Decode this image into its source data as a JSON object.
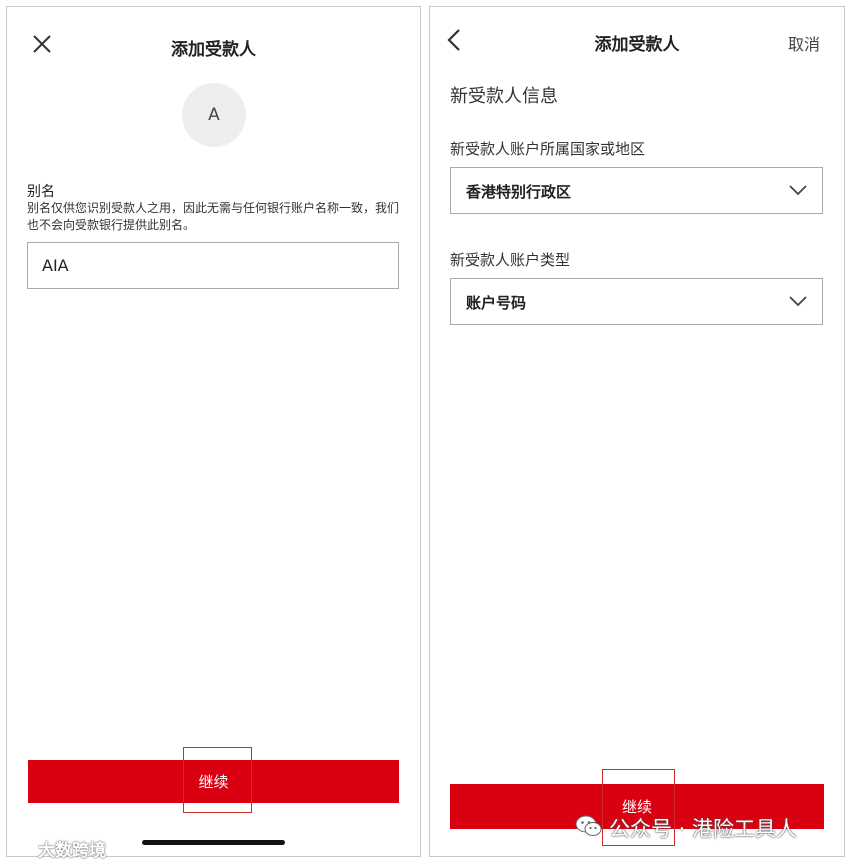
{
  "screen_left": {
    "title": "添加受款人",
    "avatar_letter": "A",
    "alias_label": "别名",
    "alias_help": "别名仅供您识别受款人之用，因此无需与任何银行账户名称一致，我们也不会向受款银行提供此别名。",
    "alias_value": "AIA",
    "continue_label": "继续"
  },
  "screen_right": {
    "title": "添加受款人",
    "cancel_label": "取消",
    "section_title": "新受款人信息",
    "country_label": "新受款人账户所属国家或地区",
    "country_value": "香港特别行政区",
    "account_type_label": "新受款人账户类型",
    "account_type_value": "账户号码",
    "continue_label": "继续"
  },
  "watermarks": {
    "left": "大数跨境",
    "right": "公众号 · 港险工具人"
  },
  "colors": {
    "primary_red": "#db0011",
    "highlight_box": "#c9302c"
  },
  "icons": {
    "close": "close-icon",
    "back": "chevron-left-icon",
    "dropdown": "chevron-down-icon",
    "wechat": "wechat-icon",
    "logo": "logo-icon"
  }
}
